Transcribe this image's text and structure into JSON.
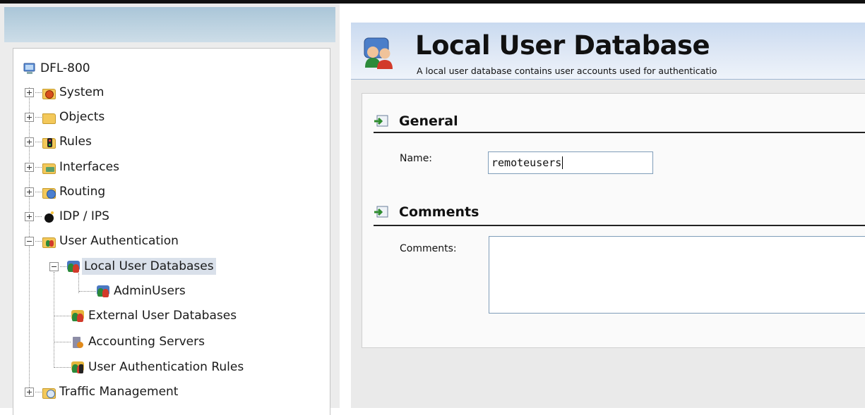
{
  "tree": {
    "root": "DFL-800",
    "items": [
      {
        "label": "System",
        "icon": "gear-folder-icon"
      },
      {
        "label": "Objects",
        "icon": "folder-icon"
      },
      {
        "label": "Rules",
        "icon": "traffic-light-folder-icon"
      },
      {
        "label": "Interfaces",
        "icon": "network-folder-icon"
      },
      {
        "label": "Routing",
        "icon": "globe-folder-icon"
      },
      {
        "label": "IDP / IPS",
        "icon": "bomb-icon"
      },
      {
        "label": "User Authentication",
        "icon": "users-folder-icon"
      },
      {
        "label": "Local User Databases",
        "icon": "users-icon",
        "selected": true
      },
      {
        "label": "AdminUsers",
        "icon": "users-icon"
      },
      {
        "label": "External User Databases",
        "icon": "users-icon"
      },
      {
        "label": "Accounting Servers",
        "icon": "server-user-icon"
      },
      {
        "label": "User Authentication Rules",
        "icon": "users-rule-icon"
      },
      {
        "label": "Traffic Management",
        "icon": "clock-folder-icon"
      }
    ]
  },
  "page": {
    "title": "Local User Database",
    "subtitle": "A local user database contains user accounts used for authenticatio"
  },
  "general": {
    "heading": "General",
    "name_label": "Name:",
    "name_value": "remoteusers"
  },
  "comments": {
    "heading": "Comments",
    "label": "Comments:",
    "value": ""
  },
  "colors": {
    "title_gradient_top": "#c9daf0",
    "selection": "#d9e0ea",
    "folder": "#f3c85a"
  }
}
